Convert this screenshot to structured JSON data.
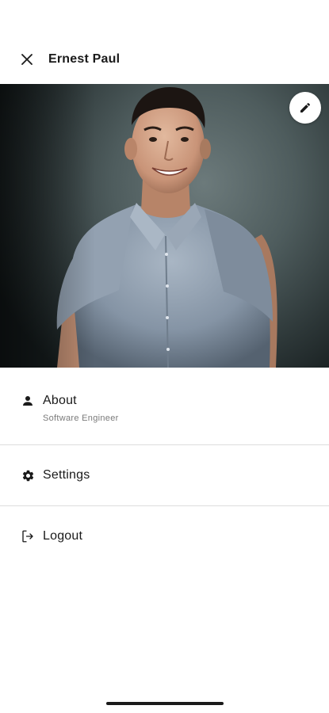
{
  "header": {
    "title": "Ernest Paul",
    "close_icon": "close-icon"
  },
  "profile_photo": {
    "edit_icon": "pencil-icon"
  },
  "menu": {
    "about": {
      "icon": "person-icon",
      "label": "About",
      "subtitle": "Software Engineer"
    },
    "settings": {
      "icon": "gear-icon",
      "label": "Settings"
    },
    "logout": {
      "icon": "logout-icon",
      "label": "Logout"
    }
  },
  "colors": {
    "text": "#1a1a1a",
    "subtitle": "#7a7a7a",
    "divider": "#dcdcdc",
    "background": "#ffffff"
  }
}
